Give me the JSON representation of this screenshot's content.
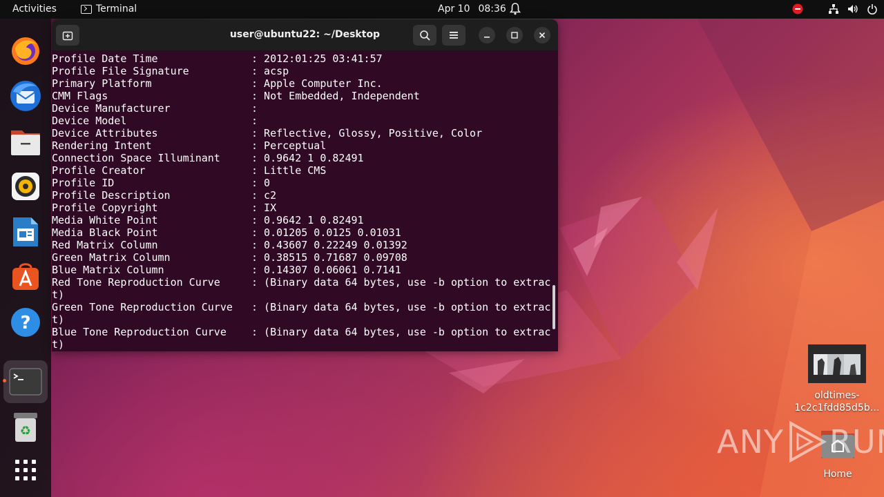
{
  "topbar": {
    "activities": "Activities",
    "app_name": "Terminal",
    "date": "Apr 10",
    "time": "08:36"
  },
  "dock": {
    "items": [
      {
        "name": "firefox",
        "icon": "firefox-icon"
      },
      {
        "name": "thunderbird",
        "icon": "thunderbird-icon"
      },
      {
        "name": "files",
        "icon": "files-icon"
      },
      {
        "name": "rhythmbox",
        "icon": "rhythmbox-icon"
      },
      {
        "name": "libreoffice-writer",
        "icon": "writer-icon"
      },
      {
        "name": "app-center",
        "icon": "app-center-icon"
      },
      {
        "name": "help",
        "icon": "help-icon"
      },
      {
        "name": "terminal",
        "icon": "terminal-icon",
        "active": true
      },
      {
        "name": "trash",
        "icon": "trash-icon"
      },
      {
        "name": "show-apps",
        "icon": "app-grid-icon"
      }
    ]
  },
  "terminal": {
    "title": "user@ubuntu22: ~/Desktop",
    "lines": [
      "Profile Date Time               : 2012:01:25 03:41:57",
      "Profile File Signature          : acsp",
      "Primary Platform                : Apple Computer Inc.",
      "CMM Flags                       : Not Embedded, Independent",
      "Device Manufacturer             :",
      "Device Model                    :",
      "Device Attributes               : Reflective, Glossy, Positive, Color",
      "Rendering Intent                : Perceptual",
      "Connection Space Illuminant     : 0.9642 1 0.82491",
      "Profile Creator                 : Little CMS",
      "Profile ID                      : 0",
      "Profile Description             : c2",
      "Profile Copyright               : IX",
      "Media White Point               : 0.9642 1 0.82491",
      "Media Black Point               : 0.01205 0.0125 0.01031",
      "Red Matrix Column               : 0.43607 0.22249 0.01392",
      "Green Matrix Column             : 0.38515 0.71687 0.09708",
      "Blue Matrix Column              : 0.14307 0.06061 0.7141",
      "Red Tone Reproduction Curve     : (Binary data 64 bytes, use -b option to extrac",
      "t)",
      "Green Tone Reproduction Curve   : (Binary data 64 bytes, use -b option to extrac",
      "t)",
      "Blue Tone Reproduction Curve    : (Binary data 64 bytes, use -b option to extrac",
      "t)"
    ]
  },
  "desktop": {
    "file_label_line1": "oldtimes-",
    "file_label_line2": "1c2c1fdd85d5b…",
    "home_label": "Home"
  },
  "watermark": {
    "left": "ANY",
    "right": "RUN"
  },
  "colors": {
    "terminal_bg": "#300a24",
    "titlebar_bg": "#1e1e1e",
    "topbar_bg": "#0f0f0f",
    "accent": "#e95420"
  }
}
